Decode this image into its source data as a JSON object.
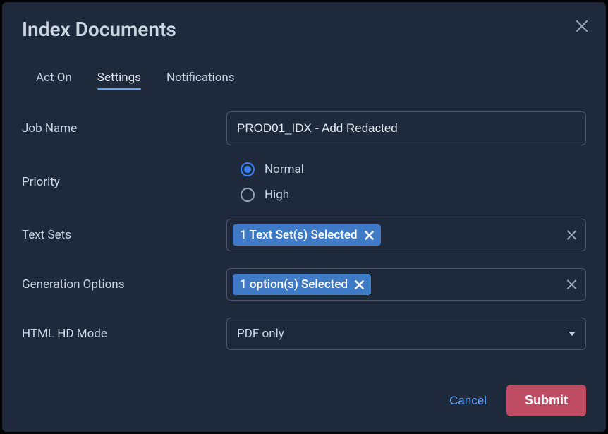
{
  "dialog": {
    "title": "Index Documents"
  },
  "tabs": [
    {
      "label": "Act On",
      "active": false
    },
    {
      "label": "Settings",
      "active": true
    },
    {
      "label": "Notifications",
      "active": false
    }
  ],
  "form": {
    "jobName": {
      "label": "Job Name",
      "value": "PROD01_IDX - Add Redacted"
    },
    "priority": {
      "label": "Priority",
      "options": [
        {
          "label": "Normal",
          "selected": true
        },
        {
          "label": "High",
          "selected": false
        }
      ]
    },
    "textSets": {
      "label": "Text Sets",
      "chip": "1 Text Set(s) Selected"
    },
    "generationOptions": {
      "label": "Generation Options",
      "chip": "1 option(s) Selected"
    },
    "htmlHdMode": {
      "label": "HTML HD Mode",
      "value": "PDF only"
    }
  },
  "footer": {
    "cancel": "Cancel",
    "submit": "Submit"
  }
}
